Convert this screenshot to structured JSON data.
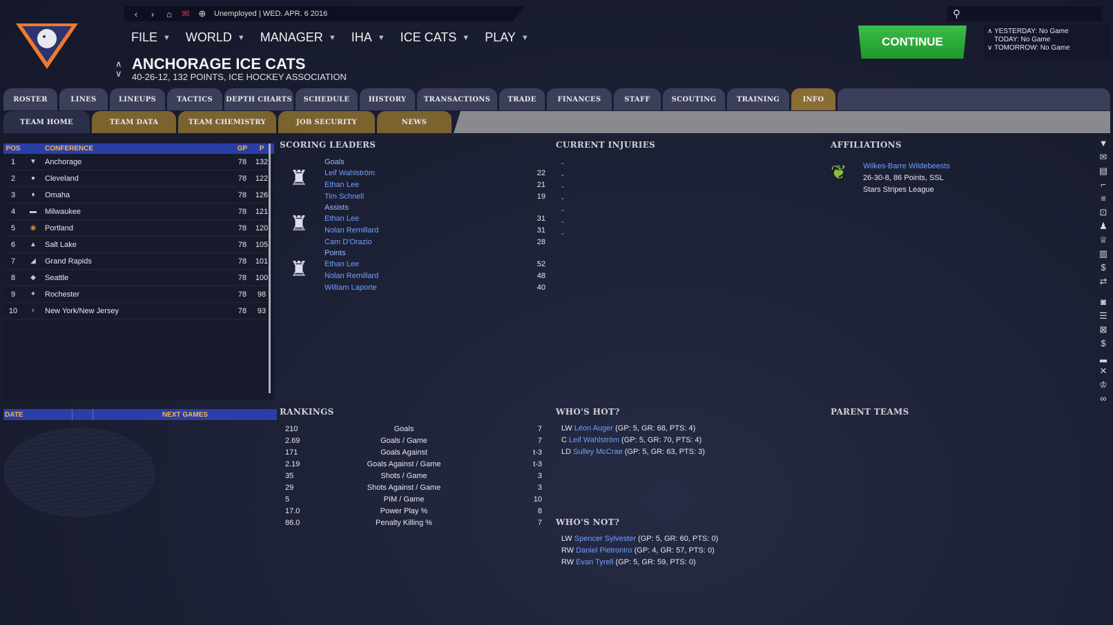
{
  "header": {
    "status": "Unemployed | WED. APR. 6 2016",
    "menu": [
      {
        "label": "FILE"
      },
      {
        "label": "WORLD"
      },
      {
        "label": "MANAGER"
      },
      {
        "label": "IHA"
      },
      {
        "label": "ICE CATS"
      },
      {
        "label": "PLAY"
      }
    ],
    "team_name": "ANCHORAGE ICE CATS",
    "team_sub": "40-26-12, 132 POINTS, ICE HOCKEY ASSOCIATION",
    "continue_label": "CONTINUE",
    "yesterday": "YESTERDAY: No Game",
    "today": "TODAY: No Game",
    "tomorrow": "TOMORROW: No Game"
  },
  "tabs": [
    "ROSTER",
    "LINES",
    "LINEUPS",
    "TACTICS",
    "DEPTH CHARTS",
    "SCHEDULE",
    "HISTORY",
    "TRANSACTIONS",
    "TRADE",
    "FINANCES",
    "STAFF",
    "SCOUTING",
    "TRAINING",
    "INFO"
  ],
  "subtabs": [
    "TEAM HOME",
    "TEAM DATA",
    "TEAM CHEMISTRY",
    "JOB SECURITY",
    "NEWS"
  ],
  "standings": {
    "headers": {
      "pos": "POS",
      "conf": "CONFERENCE",
      "gp": "GP",
      "p": "P"
    },
    "rows": [
      {
        "pos": "1",
        "name": "Anchorage",
        "gp": "78",
        "p": "132"
      },
      {
        "pos": "2",
        "name": "Cleveland",
        "gp": "78",
        "p": "122"
      },
      {
        "pos": "3",
        "name": "Omaha",
        "gp": "78",
        "p": "126"
      },
      {
        "pos": "4",
        "name": "Milwaukee",
        "gp": "78",
        "p": "121"
      },
      {
        "pos": "5",
        "name": "Portland",
        "gp": "78",
        "p": "120"
      },
      {
        "pos": "6",
        "name": "Salt Lake",
        "gp": "78",
        "p": "105"
      },
      {
        "pos": "7",
        "name": "Grand Rapids",
        "gp": "78",
        "p": "101"
      },
      {
        "pos": "8",
        "name": "Seattle",
        "gp": "78",
        "p": "100"
      },
      {
        "pos": "9",
        "name": "Rochester",
        "gp": "78",
        "p": "98"
      },
      {
        "pos": "10",
        "name": "New York/New Jersey",
        "gp": "78",
        "p": "93"
      }
    ]
  },
  "next_games": {
    "date": "DATE",
    "title": "NEXT GAMES"
  },
  "scoring": {
    "title": "SCORING LEADERS",
    "groups": [
      {
        "cat": "Goals",
        "rows": [
          {
            "n": "Leif Wahlström",
            "v": "22"
          },
          {
            "n": "Ethan Lee",
            "v": "21"
          },
          {
            "n": "Tim Schnell",
            "v": "19"
          }
        ]
      },
      {
        "cat": "Assists",
        "rows": [
          {
            "n": "Ethan Lee",
            "v": "31"
          },
          {
            "n": "Nolan Remillard",
            "v": "31"
          },
          {
            "n": "Cam D'Orazio",
            "v": "28"
          }
        ]
      },
      {
        "cat": "Points",
        "rows": [
          {
            "n": "Ethan Lee",
            "v": "52"
          },
          {
            "n": "Nolan Remillard",
            "v": "48"
          },
          {
            "n": "William Laporte",
            "v": "40"
          }
        ]
      }
    ]
  },
  "injuries": {
    "title": "CURRENT INJURIES",
    "rows": [
      "-",
      "-",
      "-",
      "-",
      "-",
      "-",
      "-"
    ]
  },
  "affiliations": {
    "title": "AFFILIATIONS",
    "team": "Wilkes-Barre Wildebeests",
    "record": "26-30-8, 86 Points, SSL",
    "league": "Stars Stripes League"
  },
  "rankings": {
    "title": "RANKINGS",
    "rows": [
      {
        "v": "210",
        "l": "Goals",
        "r": "7"
      },
      {
        "v": "2.69",
        "l": "Goals / Game",
        "r": "7"
      },
      {
        "v": "171",
        "l": "Goals Against",
        "r": "t-3"
      },
      {
        "v": "2.19",
        "l": "Goals Against / Game",
        "r": "t-3"
      },
      {
        "v": "35",
        "l": "Shots / Game",
        "r": "3"
      },
      {
        "v": "29",
        "l": "Shots Against / Game",
        "r": "3"
      },
      {
        "v": "5",
        "l": "PIM / Game",
        "r": "10"
      },
      {
        "v": "17.0",
        "l": "Power Play %",
        "r": "8"
      },
      {
        "v": "86.0",
        "l": "Penalty Killing %",
        "r": "7"
      }
    ]
  },
  "hot": {
    "title": "WHO'S HOT?",
    "rows": [
      {
        "pos": "LW",
        "n": "Léon Auger",
        "s": "(GP: 5, GR: 68, PTS: 4)"
      },
      {
        "pos": "C",
        "n": "Leif Wahlström",
        "s": "(GP: 5, GR: 70, PTS: 4)"
      },
      {
        "pos": "LD",
        "n": "Sulley McCrae",
        "s": "(GP: 5, GR: 63, PTS: 3)"
      }
    ]
  },
  "not": {
    "title": "WHO'S NOT?",
    "rows": [
      {
        "pos": "LW",
        "n": "Spencer Sylvester",
        "s": "(GP: 5, GR: 60, PTS: 0)"
      },
      {
        "pos": "RW",
        "n": "Daniel Pietroniro",
        "s": "(GP: 4, GR: 57, PTS: 0)"
      },
      {
        "pos": "RW",
        "n": "Evan Tyrell",
        "s": "(GP: 5, GR: 59, PTS: 0)"
      }
    ]
  },
  "parent": {
    "title": "PARENT TEAMS"
  }
}
